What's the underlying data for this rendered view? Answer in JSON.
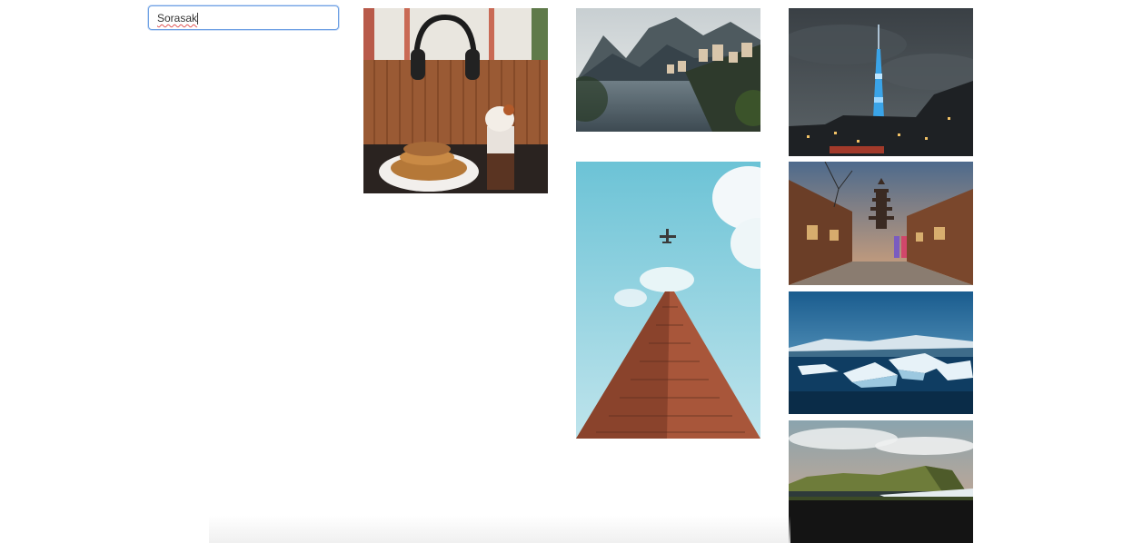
{
  "search": {
    "value": "Sorasak"
  },
  "gallery": {
    "tiles": [
      {
        "icon": "cafe-headphones-pancakes-photo"
      },
      {
        "icon": "mountain-lake-village-photo"
      },
      {
        "icon": "skytree-tower-night-photo"
      },
      {
        "icon": "skyscraper-airplane-photo"
      },
      {
        "icon": "kyoto-pagoda-street-photo"
      },
      {
        "icon": "glacier-lagoon-icebergs-photo"
      },
      {
        "icon": "coastal-cliff-sunset-photo"
      }
    ]
  },
  "colors": {
    "focus_border": "#6ea0e4",
    "spellcheck_underline": "#e05555"
  }
}
